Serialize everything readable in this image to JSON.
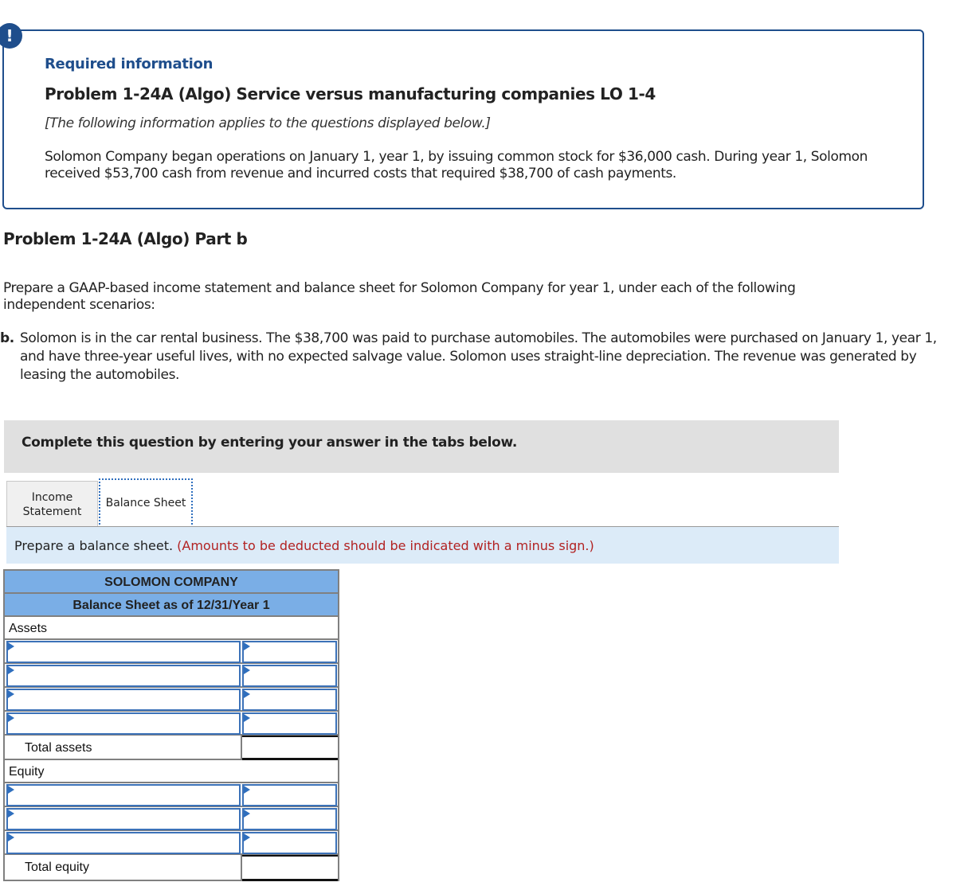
{
  "required_info": {
    "badge": "!",
    "title": "Required information",
    "problem_title": "Problem 1-24A (Algo) Service versus manufacturing companies LO 1-4",
    "applies_note": "[The following information applies to the questions displayed below.]",
    "paragraph": "Solomon Company began operations on January 1, year 1, by issuing common stock for $36,000 cash. During year 1, Solomon received $53,700 cash from revenue and incurred costs that required $38,700 of cash payments."
  },
  "part": {
    "title": "Problem 1-24A (Algo) Part b",
    "instructions": "Prepare a GAAP-based income statement and balance sheet for Solomon Company for year 1, under each of the following independent scenarios:",
    "scenario_letter": "b.",
    "scenario_text": "Solomon is in the car rental business. The $38,700 was paid to purchase automobiles. The automobiles were purchased on January 1, year 1, and have three-year useful lives, with no expected salvage value. Solomon uses straight-line depreciation. The revenue was generated by leasing the automobiles."
  },
  "complete_bar": {
    "text": "Complete this question by entering your answer in the tabs below."
  },
  "tabs": [
    {
      "label": "Income Statement",
      "active": false
    },
    {
      "label": "Balance Sheet",
      "active": true
    }
  ],
  "prompt": {
    "text": "Prepare a balance sheet.",
    "note": "(Amounts to be deducted should be indicated with a minus sign.)"
  },
  "balance_sheet": {
    "company": "SOLOMON COMPANY",
    "subtitle": "Balance Sheet as of 12/31/Year 1",
    "assets_label": "Assets",
    "assets_rows": [
      {
        "label": "",
        "amount": ""
      },
      {
        "label": "",
        "amount": ""
      },
      {
        "label": "",
        "amount": ""
      },
      {
        "label": "",
        "amount": ""
      }
    ],
    "total_assets_label": "Total assets",
    "total_assets_value": "",
    "equity_label": "Equity",
    "equity_rows": [
      {
        "label": "",
        "amount": ""
      },
      {
        "label": "",
        "amount": ""
      },
      {
        "label": "",
        "amount": ""
      }
    ],
    "total_equity_label": "Total equity",
    "total_equity_value": ""
  },
  "colors": {
    "accent_dark_blue": "#1f4e8c",
    "table_header_blue": "#7aaee6",
    "prompt_bg": "#dcebf8",
    "note_red": "#b22222",
    "complete_bar_bg": "#e0e0e0"
  }
}
